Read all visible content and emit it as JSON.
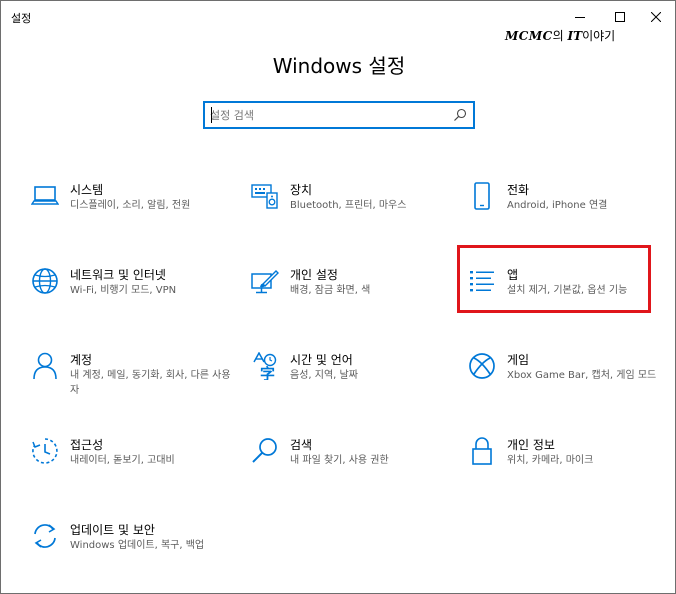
{
  "window": {
    "title": "설정",
    "accent": "#0078d7",
    "highlight_color": "#e0161b"
  },
  "watermark": {
    "brand": "MCMC",
    "connector": "의 ",
    "it": "IT",
    "suffix": "이야기"
  },
  "header": {
    "title": "Windows 설정"
  },
  "search": {
    "placeholder": "설정 검색",
    "icon": "search-icon"
  },
  "tiles": [
    {
      "key": "system",
      "name": "시스템",
      "desc": "디스플레이, 소리, 알림, 전원",
      "icon": "laptop-icon"
    },
    {
      "key": "devices",
      "name": "장치",
      "desc": "Bluetooth, 프린터, 마우스",
      "icon": "keyboard-speaker-icon"
    },
    {
      "key": "phone",
      "name": "전화",
      "desc": "Android, iPhone 연결",
      "icon": "phone-icon"
    },
    {
      "key": "network",
      "name": "네트워크 및 인터넷",
      "desc": "Wi-Fi, 비행기 모드, VPN",
      "icon": "globe-icon"
    },
    {
      "key": "personalization",
      "name": "개인 설정",
      "desc": "배경, 잠금 화면, 색",
      "icon": "paint-icon"
    },
    {
      "key": "apps",
      "name": "앱",
      "desc": "설치 제거, 기본값, 옵션 기능",
      "icon": "apps-list-icon",
      "highlighted": true
    },
    {
      "key": "accounts",
      "name": "계정",
      "desc": "내 계정, 메일, 동기화, 회사, 다른 사용자",
      "icon": "person-icon"
    },
    {
      "key": "time-language",
      "name": "시간 및 언어",
      "desc": "음성, 지역, 날짜",
      "icon": "time-language-icon"
    },
    {
      "key": "gaming",
      "name": "게임",
      "desc": "Xbox Game Bar, 캡처, 게임 모드",
      "icon": "xbox-icon"
    },
    {
      "key": "ease-of-access",
      "name": "접근성",
      "desc": "내레이터, 돋보기, 고대비",
      "icon": "ease-of-access-icon"
    },
    {
      "key": "search",
      "name": "검색",
      "desc": "내 파일 찾기, 사용 권한",
      "icon": "search-icon"
    },
    {
      "key": "privacy",
      "name": "개인 정보",
      "desc": "위치, 카메라, 마이크",
      "icon": "lock-icon"
    },
    {
      "key": "update-security",
      "name": "업데이트 및 보안",
      "desc": "Windows 업데이트, 복구, 백업",
      "icon": "refresh-icon"
    }
  ]
}
